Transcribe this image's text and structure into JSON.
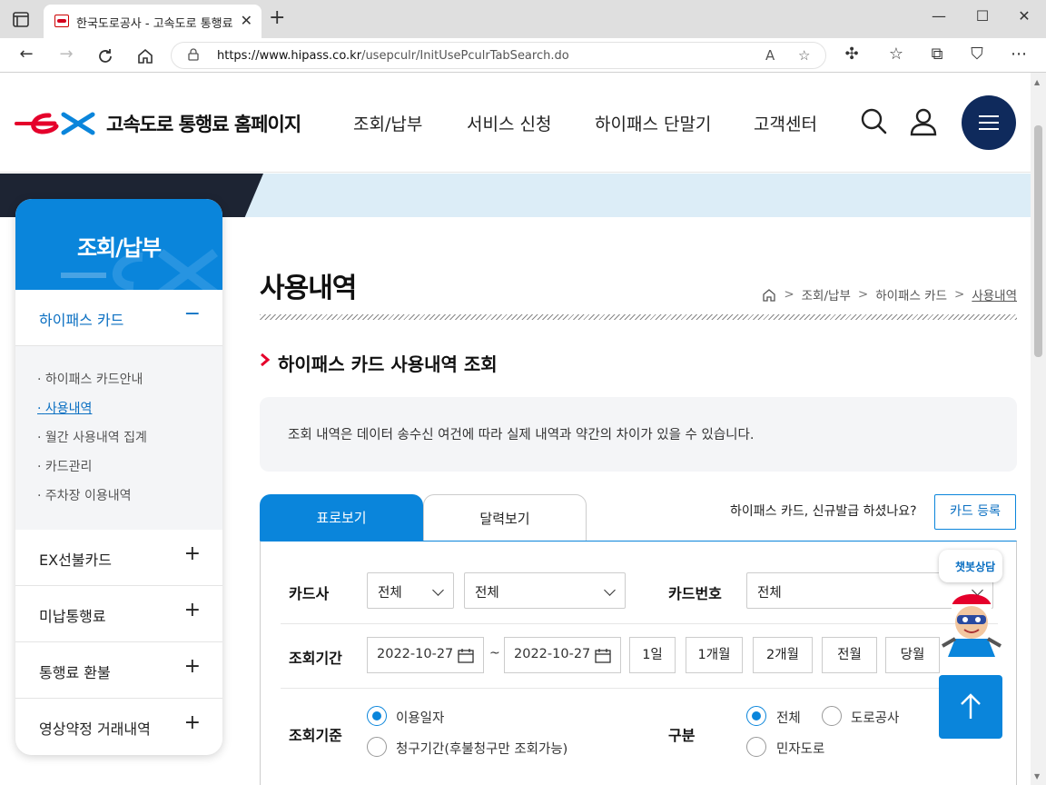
{
  "browser": {
    "tab_title": "한국도로공사 - 고속도로 통행료",
    "url_host": "https://www.hipass.co.kr",
    "url_path": "/usepculr/InitUsePculrTabSearch.do",
    "new_tab": "+",
    "close": "✕",
    "minimize": "—",
    "maximize": "☐",
    "win_close": "✕"
  },
  "header": {
    "site_title": "고속도로 통행료 홈페이지",
    "nav": [
      "조회/납부",
      "서비스 신청",
      "하이패스 단말기",
      "고객센터"
    ]
  },
  "sidebar": {
    "title": "조회/납부",
    "categories": [
      {
        "label": "하이패스 카드",
        "toggle": "−"
      },
      {
        "label": "EX선불카드",
        "toggle": "+"
      },
      {
        "label": "미납통행료",
        "toggle": "+"
      },
      {
        "label": "통행료 환불",
        "toggle": "+"
      },
      {
        "label": "영상약정 거래내역",
        "toggle": "+"
      }
    ],
    "sub_items": [
      "하이패스 카드안내",
      "사용내역",
      "월간 사용내역 집계",
      "카드관리",
      "주차장 이용내역"
    ],
    "bullet": "·"
  },
  "main": {
    "page_title": "사용내역",
    "breadcrumb": [
      "조회/납부",
      "하이패스 카드",
      "사용내역"
    ],
    "crumb_sep": ">",
    "section_title": "하이패스 카드 사용내역 조회",
    "notice": "조회 내역은 데이터 송수신 여건에 따라 실제 내역과 약간의 차이가 있을 수 있습니다.",
    "tabs": [
      "표로보기",
      "달력보기"
    ],
    "new_card_question": "하이패스 카드, 신규발급 하셨나요?",
    "card_register": "카드 등록"
  },
  "form": {
    "card_company_label": "카드사",
    "card_company_value1": "전체",
    "card_company_value2": "전체",
    "card_number_label": "카드번호",
    "card_number_value": "전체",
    "period_label": "조회기간",
    "date_from": "2022-10-27",
    "date_to": "2022-10-27",
    "tilde": "~",
    "period_buttons": [
      "1일",
      "1개월",
      "2개월",
      "전월",
      "당월"
    ],
    "basis_label": "조회기준",
    "basis_options": [
      "이용일자",
      "청구기간(후불청구만 조회가능)"
    ],
    "type_label": "구분",
    "type_options": [
      "전체",
      "도로공사",
      "민자도로"
    ]
  },
  "floating": {
    "chatbot_label": "챗봇상담"
  },
  "colors": {
    "primary": "#0a85db",
    "navy": "#0f2a5c",
    "brand_red": "#e5002b"
  }
}
